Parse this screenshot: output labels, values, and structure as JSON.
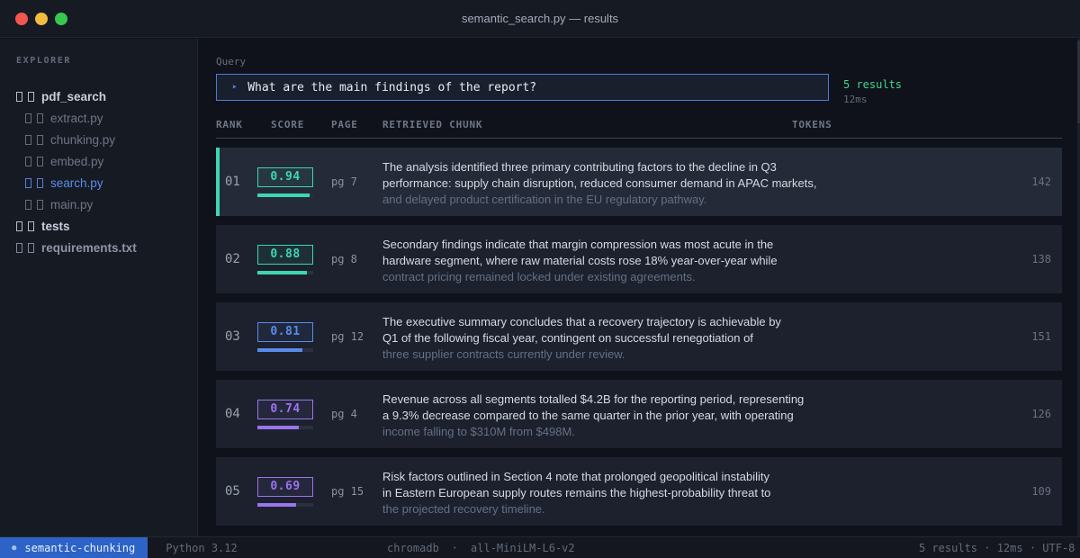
{
  "window": {
    "title": "semantic_search.py — results",
    "traffic": {
      "close": "#f4564e",
      "minimize": "#f3bc3f",
      "maximize": "#36c84f"
    }
  },
  "sidebar": {
    "header": "EXPLORER",
    "items": [
      {
        "label": "pdf_search",
        "indent": 0,
        "icons": 1,
        "cls": "bright",
        "bold": true
      },
      {
        "label": "extract.py",
        "indent": 1,
        "icons": 1,
        "cls": "dim",
        "bold": false
      },
      {
        "label": "chunking.py",
        "indent": 1,
        "icons": 1,
        "cls": "dim",
        "bold": false
      },
      {
        "label": "embed.py",
        "indent": 1,
        "icons": 1,
        "cls": "dim",
        "bold": false
      },
      {
        "label": "search.py",
        "indent": 1,
        "icons": 2,
        "cls": "active",
        "bold": false
      },
      {
        "label": "main.py",
        "indent": 1,
        "icons": 1,
        "cls": "dim",
        "bold": false
      },
      {
        "label": "tests",
        "indent": 0,
        "icons": 1,
        "cls": "bright",
        "bold": true
      },
      {
        "label": "requirements.txt",
        "indent": 0,
        "icons": 1,
        "cls": "muted",
        "bold": true
      }
    ]
  },
  "query": {
    "label": "Query",
    "prompt_icon": "‣",
    "text": "What are the main findings of the report?",
    "results_count": "5 results",
    "latency": "12ms"
  },
  "table": {
    "headers": [
      "RANK",
      "SCORE",
      "PAGE",
      "RETRIEVED CHUNK",
      "TOKENS"
    ]
  },
  "colors": {
    "teal": "#3dd6b5",
    "blue": "#5a8bec",
    "purple": "#9b74ee"
  },
  "results": [
    {
      "rank": "01",
      "score": "0.94",
      "pct": 94,
      "tone": "teal",
      "page": "pg 7",
      "tokens": "142",
      "highlight": true,
      "lines": [
        "The analysis identified three primary contributing factors to the decline in Q3",
        "performance: supply chain disruption, reduced consumer demand in APAC markets,",
        "and delayed product certification in the EU regulatory pathway."
      ]
    },
    {
      "rank": "02",
      "score": "0.88",
      "pct": 88,
      "tone": "teal",
      "page": "pg 8",
      "tokens": "138",
      "highlight": false,
      "lines": [
        "Secondary findings indicate that margin compression was most acute in the",
        "hardware segment, where raw material costs rose 18% year-over-year while",
        "contract pricing remained locked under existing agreements."
      ]
    },
    {
      "rank": "03",
      "score": "0.81",
      "pct": 81,
      "tone": "blue",
      "page": "pg 12",
      "tokens": "151",
      "highlight": false,
      "lines": [
        "The executive summary concludes that a recovery trajectory is achievable by",
        "Q1 of the following fiscal year, contingent on successful renegotiation of",
        "three supplier contracts currently under review."
      ]
    },
    {
      "rank": "04",
      "score": "0.74",
      "pct": 74,
      "tone": "purple",
      "page": "pg 4",
      "tokens": "126",
      "highlight": false,
      "lines": [
        "Revenue across all segments totalled $4.2B for the reporting period, representing",
        "a 9.3% decrease compared to the same quarter in the prior year, with operating",
        "income falling to $310M from $498M."
      ]
    },
    {
      "rank": "05",
      "score": "0.69",
      "pct": 69,
      "tone": "purple",
      "page": "pg 15",
      "tokens": "109",
      "highlight": false,
      "lines": [
        "Risk factors outlined in Section 4 note that prolonged geopolitical instability",
        "in Eastern European supply routes remains the highest-probability threat to",
        "the projected recovery timeline."
      ]
    }
  ],
  "statusbar": {
    "badge_dot": "●",
    "badge_label": "semantic-chunking",
    "python": "Python 3.12",
    "engine": "chromadb",
    "sep": "·",
    "model": "all-MiniLM-L6-v2",
    "right": "5 results · 12ms · UTF-8"
  }
}
